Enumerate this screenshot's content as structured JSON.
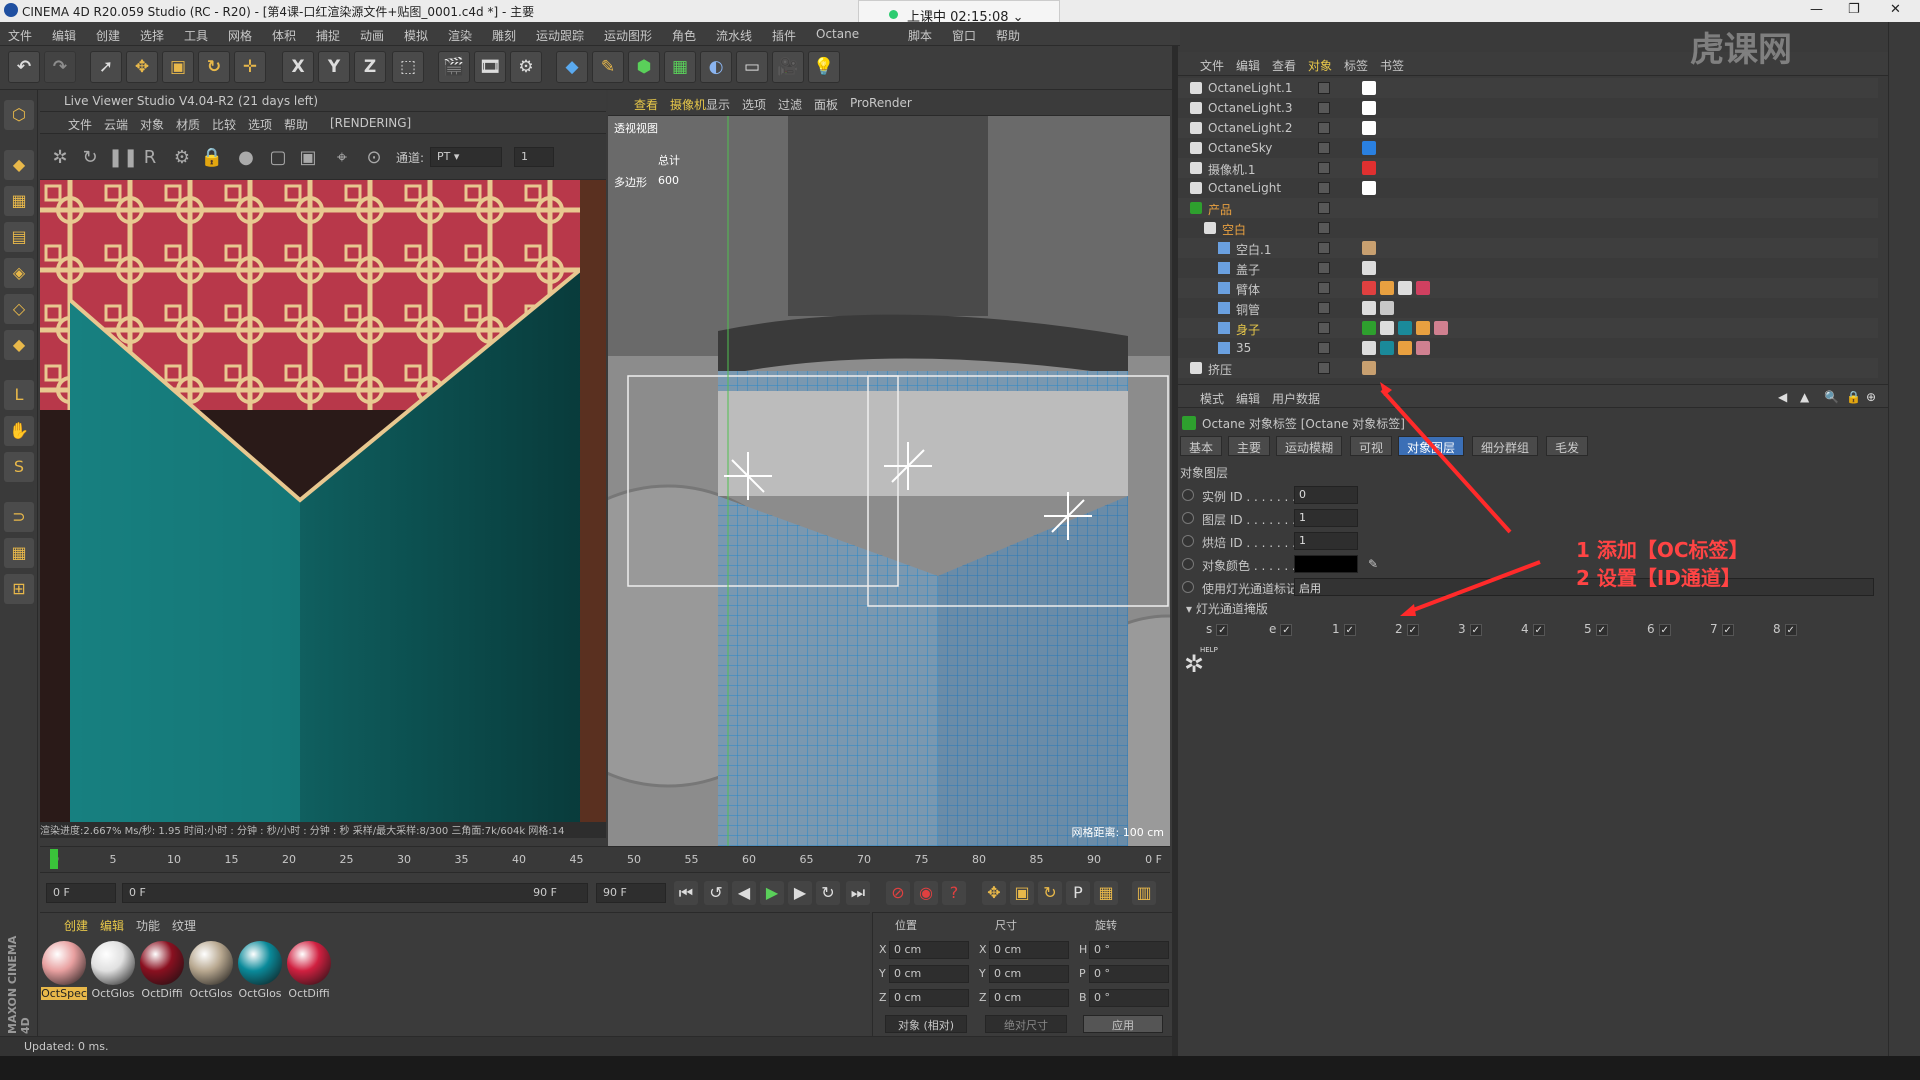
{
  "window": {
    "title": "CINEMA 4D R20.059 Studio (RC - R20) - [第4课-口红渲染源文件+贴图_0001.c4d *] - 主要",
    "live_badge": "上课中 02:15:08"
  },
  "menubar": [
    "文件",
    "编辑",
    "创建",
    "选择",
    "工具",
    "网格",
    "体积",
    "捕捉",
    "动画",
    "模拟",
    "渲染",
    "雕刻",
    "运动跟踪",
    "运动图形",
    "角色",
    "流水线",
    "插件",
    "Octane",
    "脚本",
    "窗口",
    "帮助"
  ],
  "toolbar": {
    "x": "X",
    "y": "Y",
    "z": "Z"
  },
  "live_viewer": {
    "title": "Live Viewer Studio V4.04-R2 (21 days left)",
    "menus": [
      "文件",
      "云端",
      "对象",
      "材质",
      "比较",
      "选项",
      "帮助"
    ],
    "state": "[RENDERING]",
    "channel_label": "通道:",
    "channel_value": "PT",
    "channel_num": "1",
    "status": "渲染进度:2.667%   Ms/秒: 1.95   时间:小时 : 分钟 : 秒/小时 : 分钟 : 秒   采样/最大采样:8/300   三角面:7k/604k   网格:14"
  },
  "viewport": {
    "menus": [
      "查看",
      "摄像机",
      "显示",
      "选项",
      "过滤",
      "面板",
      "ProRender"
    ],
    "view_name": "透视视图",
    "stats_label": "总计",
    "poly_label": "多边形",
    "poly_count": "600",
    "grid_info": "网格距离: 100 cm"
  },
  "timeline": {
    "ticks": [
      "0",
      "5",
      "10",
      "15",
      "20",
      "25",
      "30",
      "35",
      "40",
      "45",
      "50",
      "55",
      "60",
      "65",
      "70",
      "75",
      "80",
      "85",
      "90"
    ],
    "frame_right": "0 F"
  },
  "transport": {
    "start": "0 F",
    "range_start": "0 F",
    "range_end": "90 F",
    "end": "90 F"
  },
  "materials": {
    "tabs": [
      "创建",
      "编辑",
      "功能",
      "纹理"
    ],
    "items": [
      "OctSpec",
      "OctGlos",
      "OctDiffi",
      "OctGlos",
      "OctGlos",
      "OctDiffi"
    ],
    "colors": [
      "#e8a0a0",
      "#e0e0e0",
      "#8a1020",
      "#b8a890",
      "#0a8a9a",
      "#d02040"
    ]
  },
  "coords": {
    "headers": [
      "位置",
      "尺寸",
      "旋转"
    ],
    "rows": [
      [
        "X",
        "0 cm",
        "X",
        "0 cm",
        "H",
        "0 °"
      ],
      [
        "Y",
        "0 cm",
        "Y",
        "0 cm",
        "P",
        "0 °"
      ],
      [
        "Z",
        "0 cm",
        "Z",
        "0 cm",
        "B",
        "0 °"
      ]
    ],
    "mode": "对象 (相对)",
    "size_mode": "绝对尺寸",
    "apply": "应用"
  },
  "statusbar": "Updated: 0 ms.",
  "brand": "MAXON CINEMA 4D",
  "object_manager": {
    "menus": [
      "文件",
      "编辑",
      "查看",
      "对象",
      "标签",
      "书签"
    ],
    "rows": [
      {
        "name": "OctaneLight.1",
        "indent": 0
      },
      {
        "name": "OctaneLight.3",
        "indent": 0
      },
      {
        "name": "OctaneLight.2",
        "indent": 0
      },
      {
        "name": "OctaneSky",
        "indent": 0
      },
      {
        "name": "摄像机.1",
        "indent": 0
      },
      {
        "name": "OctaneLight",
        "indent": 0
      },
      {
        "name": "产品",
        "indent": 0
      },
      {
        "name": "空白",
        "indent": 1
      },
      {
        "name": "空白.1",
        "indent": 2
      },
      {
        "name": "盖子",
        "indent": 2
      },
      {
        "name": "臂体",
        "indent": 2
      },
      {
        "name": "铜管",
        "indent": 2
      },
      {
        "name": "身子",
        "indent": 2
      },
      {
        "name": "35",
        "indent": 2
      },
      {
        "name": "挤压",
        "indent": 0
      }
    ]
  },
  "attribute_manager": {
    "menus": [
      "模式",
      "编辑",
      "用户数据"
    ],
    "title": "Octane 对象标签 [Octane 对象标签]",
    "tabs": [
      "基本",
      "主要",
      "运动模糊",
      "可视",
      "对象图层",
      "细分群组",
      "毛发"
    ],
    "active_tab": "对象图层",
    "section": "对象图层",
    "props": [
      {
        "label": "实例 ID . . . . . . .",
        "value": "0"
      },
      {
        "label": "图层 ID . . . . . . .",
        "value": "1"
      },
      {
        "label": "烘焙 ID . . . . . . .",
        "value": "1"
      },
      {
        "label": "对象颜色 . . . . . .",
        "value": ""
      },
      {
        "label": "使用灯光通道标记",
        "value": "启用"
      }
    ],
    "mask_section": "▾ 灯光通道掩版",
    "mask": [
      "s",
      "e",
      "1",
      "2",
      "3",
      "4",
      "5",
      "6",
      "7",
      "8"
    ],
    "help": "HELP"
  },
  "annotation": [
    "1 添加【OC标签】",
    "2 设置【ID通道】"
  ],
  "watermark": "虎课网"
}
